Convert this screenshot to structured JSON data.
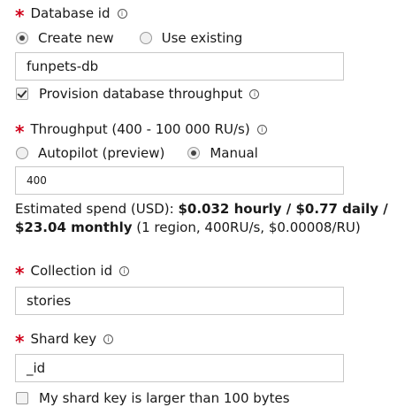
{
  "database": {
    "label": "Database id",
    "info_glyph": "i",
    "radio_create": "Create new",
    "radio_existing": "Use existing",
    "value": "funpets-db",
    "provision_label": "Provision database throughput"
  },
  "throughput": {
    "label": "Throughput (400 - 100 000 RU/s)",
    "radio_autopilot": "Autopilot (preview)",
    "radio_manual": "Manual",
    "value": "400"
  },
  "spend": {
    "prefix": "Estimated spend (USD): ",
    "amount": "$0.032 hourly / $0.77 daily / $23.04 monthly",
    "suffix": " (1 region, 400RU/s, $0.00008/RU)"
  },
  "collection": {
    "label": "Collection id",
    "value": "stories"
  },
  "shard": {
    "label": "Shard key",
    "value": "_id",
    "large_key_label": "My shard key is larger than 100 bytes"
  },
  "required_mark": "*",
  "colors": {
    "required": "#d0021b",
    "text": "#1a1a1a",
    "border": "#c8c8c8"
  }
}
